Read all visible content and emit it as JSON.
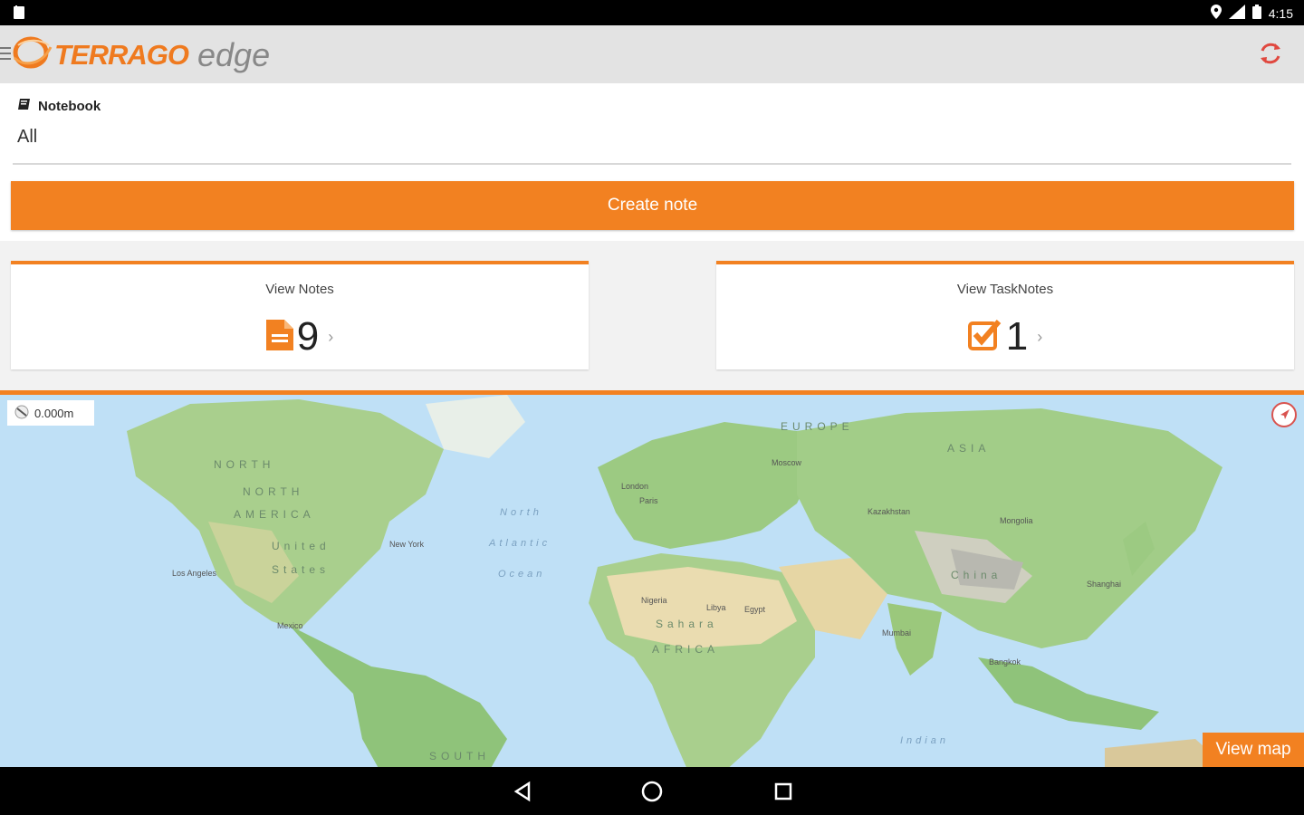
{
  "status_bar": {
    "time": "4:15",
    "icons": [
      "notification-icon",
      "location-icon",
      "signal-icon",
      "battery-icon"
    ]
  },
  "app_bar": {
    "brand": "TERRAGO",
    "product": "edge",
    "menu_icon": "hamburger-menu-icon",
    "sync_icon": "sync-icon"
  },
  "notebook": {
    "label": "Notebook",
    "value": "All"
  },
  "actions": {
    "create_note": "Create note"
  },
  "cards": {
    "notes": {
      "title": "View Notes",
      "count": "9"
    },
    "tasknotes": {
      "title": "View TaskNotes",
      "count": "1"
    }
  },
  "map": {
    "scale": "0.000m",
    "view_map": "View map",
    "labels": {
      "north_america": "NORTH",
      "america": "AMERICA",
      "united": "United",
      "states": "States",
      "north": "North",
      "atlantic": "Atlantic",
      "ocean": "Ocean",
      "europe": "EUROPE",
      "asia": "ASIA",
      "africa": "AFRICA",
      "sahara": "Sahara",
      "china": "China",
      "indian": "Indian",
      "south": "SOUTH",
      "moscow": "Moscow",
      "paris": "Paris",
      "london": "London",
      "new_york": "New York",
      "los_angeles": "Los Angeles",
      "mexico": "Mexico",
      "mumbai": "Mumbai",
      "shanghai": "Shanghai",
      "bangkok": "Bangkok",
      "egypt": "Egypt",
      "libya": "Libya",
      "nigeria": "Nigeria",
      "kazakhstan": "Kazakhstan",
      "mongolia": "Mongolia"
    }
  },
  "colors": {
    "accent": "#f28121",
    "appbar": "#e3e3e3",
    "ocean": "#bfe0f6",
    "land": "#a9cf8d",
    "desert": "#eadcb0"
  }
}
